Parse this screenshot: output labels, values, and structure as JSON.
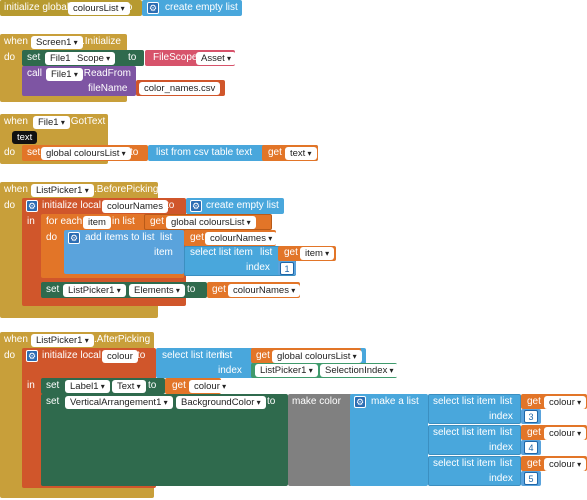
{
  "block1": {
    "initialize_global": "initialize global",
    "var_name": "coloursList",
    "to": "to",
    "create_empty_list": "create empty list"
  },
  "block2": {
    "when": "when",
    "component": "Screen1",
    "event": ".Initialize",
    "do": "do",
    "set": "set",
    "set_component": "File1",
    "set_prop": "Scope",
    "to": "to",
    "filescope": "FileScope",
    "filescope_val": "Asset",
    "call": "call",
    "call_component": "File1",
    "call_method": ".ReadFrom",
    "param_name": "fileName",
    "filename_val": "color_names.csv"
  },
  "block3": {
    "when": "when",
    "component": "File1",
    "event": ".GotText",
    "param": "text",
    "do": "do",
    "set": "set",
    "var": "global coloursList",
    "to": "to",
    "list_from_csv": "list from csv table",
    "text_label": "text",
    "get": "get",
    "get_var": "text"
  },
  "block4": {
    "when": "when",
    "component": "ListPicker1",
    "event": ".BeforePicking",
    "do": "do",
    "init_local": "initialize local",
    "local_name": "colourNames",
    "to": "to",
    "create_empty_list": "create empty list",
    "in": "in",
    "for_each": "for each",
    "item_name": "item",
    "in_list": "in list",
    "get": "get",
    "get_list": "global coloursList",
    "add_items": "add items to list",
    "list_label": "list",
    "get_colournames": "colourNames",
    "item_label": "item",
    "select_list_item": "select list item",
    "sel_list": "list",
    "get_item": "item",
    "index_label": "index",
    "index_val": "1",
    "set": "set",
    "set_component": "ListPicker1",
    "set_prop": "Elements",
    "to2": "to",
    "get_final": "colourNames"
  },
  "block5": {
    "when": "when",
    "component": "ListPicker1",
    "event": ".AfterPicking",
    "do": "do",
    "init_local": "initialize local",
    "local_name": "colour",
    "to": "to",
    "select_list_item": "select list item",
    "sel_list": "list",
    "get": "get",
    "get_list": "global coloursList",
    "index_label": "index",
    "index_component": "ListPicker1",
    "index_prop": "SelectionIndex",
    "in": "in",
    "set": "set",
    "label_component": "Label1",
    "label_prop": "Text",
    "get_colour": "colour",
    "va_component": "VerticalArrangement1",
    "va_prop": "BackgroundColor",
    "make_color": "make color",
    "make_a_list": "make a list",
    "items": [
      {
        "select": "select list item",
        "list": "list",
        "get": "get",
        "var": "colour",
        "index": "index",
        "value": "3"
      },
      {
        "select": "select list item",
        "list": "list",
        "get": "get",
        "var": "colour",
        "index": "index",
        "value": "4"
      },
      {
        "select": "select list item",
        "list": "list",
        "get": "get",
        "var": "colour",
        "index": "index",
        "value": "5"
      }
    ]
  }
}
